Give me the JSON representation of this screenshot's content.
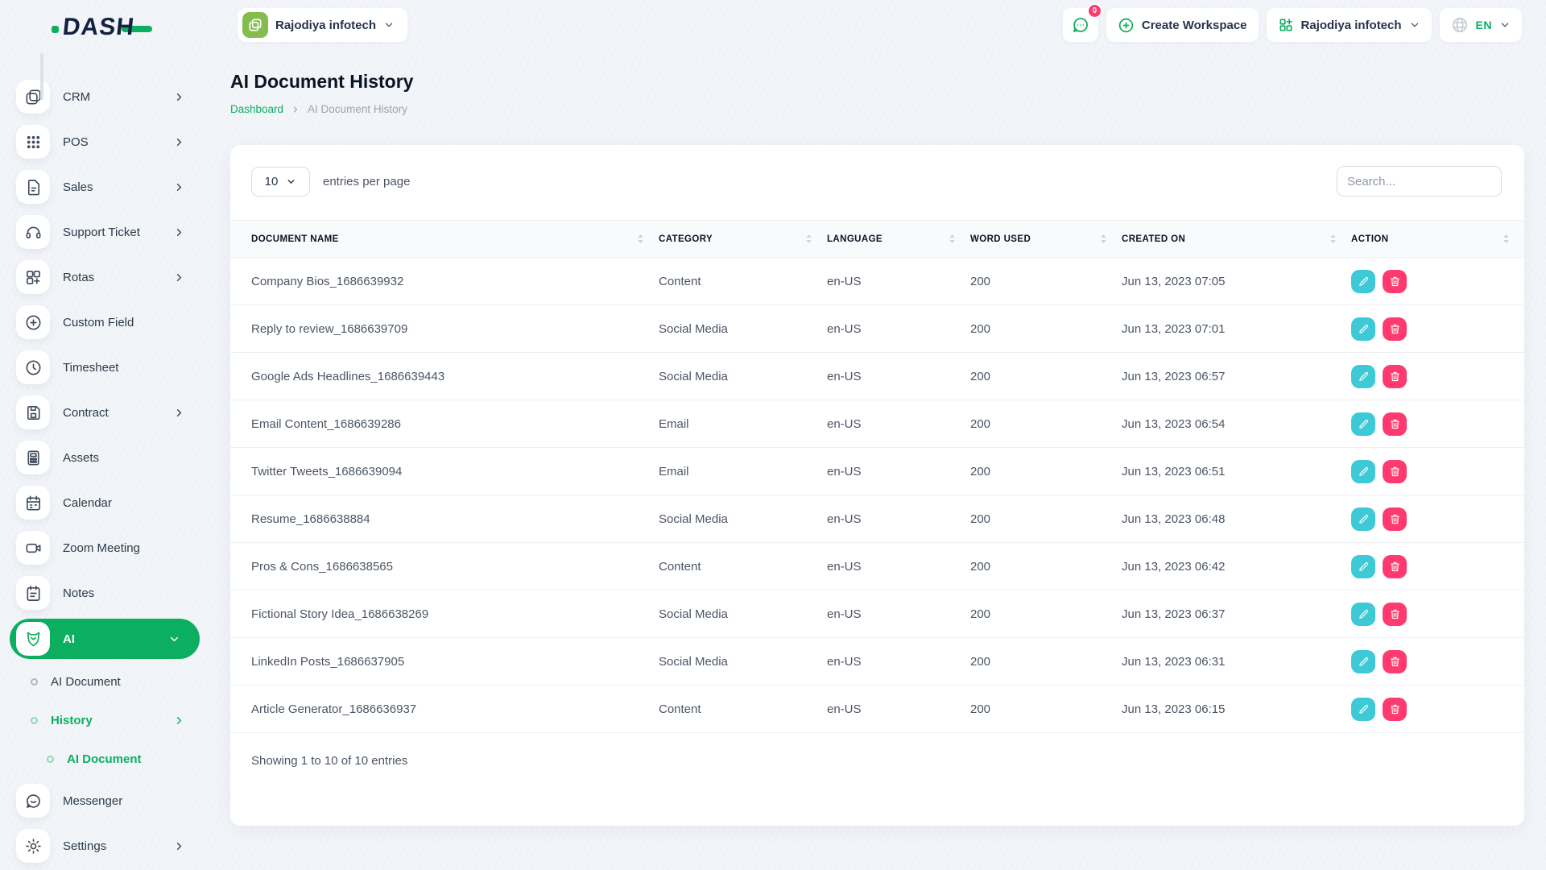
{
  "colors": {
    "accent_green": "#0caf60",
    "avatar_green": "#84bd4d",
    "edit_teal": "#3ec9d6",
    "danger_pink": "#ff3a6e",
    "dark_navy": "#13203f"
  },
  "brand": {
    "name": "DASH"
  },
  "header": {
    "workspace_switcher_label": "Rajodiya infotech",
    "messenger_badge": "0",
    "create_workspace_label": "Create Workspace",
    "company_dropdown_label": "Rajodiya infotech",
    "language_code": "EN"
  },
  "sidebar": {
    "items": [
      {
        "label": "CRM",
        "icon": "crm-icon",
        "chevron": true
      },
      {
        "label": "POS",
        "icon": "pos-icon",
        "chevron": true
      },
      {
        "label": "Sales",
        "icon": "sales-icon",
        "chevron": true
      },
      {
        "label": "Support Ticket",
        "icon": "support-ticket-icon",
        "chevron": true
      },
      {
        "label": "Rotas",
        "icon": "rotas-icon",
        "chevron": true
      },
      {
        "label": "Custom Field",
        "icon": "custom-field-icon",
        "chevron": false
      },
      {
        "label": "Timesheet",
        "icon": "timesheet-icon",
        "chevron": false
      },
      {
        "label": "Contract",
        "icon": "contract-icon",
        "chevron": true
      },
      {
        "label": "Assets",
        "icon": "assets-icon",
        "chevron": false
      },
      {
        "label": "Calendar",
        "icon": "calendar-icon",
        "chevron": false
      },
      {
        "label": "Zoom Meeting",
        "icon": "zoom-meeting-icon",
        "chevron": false
      },
      {
        "label": "Notes",
        "icon": "notes-icon",
        "chevron": false
      },
      {
        "label": "AI",
        "icon": "ai-icon",
        "active": true,
        "chevron": "down"
      },
      {
        "label": "AI Document",
        "level": 1,
        "highlight": false
      },
      {
        "label": "History",
        "level": 1,
        "highlight": true,
        "chevron": true
      },
      {
        "label": "AI Document",
        "level": 2,
        "highlight": true
      },
      {
        "label": "Messenger",
        "icon": "messenger-icon",
        "chevron": false
      },
      {
        "label": "Settings",
        "icon": "settings-icon",
        "chevron": true
      }
    ]
  },
  "page": {
    "title": "AI Document History",
    "breadcrumb_root": "Dashboard",
    "breadcrumb_current": "AI Document History"
  },
  "table_card": {
    "entries_value": "10",
    "entries_label": "entries per page",
    "search_placeholder": "Search...",
    "columns": [
      "DOCUMENT NAME",
      "CATEGORY",
      "LANGUAGE",
      "WORD USED",
      "CREATED ON",
      "ACTION"
    ],
    "rows": [
      {
        "name": "Company Bios_1686639932",
        "category": "Content",
        "language": "en-US",
        "words": "200",
        "created": "Jun 13, 2023 07:05"
      },
      {
        "name": "Reply to review_1686639709",
        "category": "Social Media",
        "language": "en-US",
        "words": "200",
        "created": "Jun 13, 2023 07:01"
      },
      {
        "name": "Google Ads Headlines_1686639443",
        "category": "Social Media",
        "language": "en-US",
        "words": "200",
        "created": "Jun 13, 2023 06:57"
      },
      {
        "name": "Email Content_1686639286",
        "category": "Email",
        "language": "en-US",
        "words": "200",
        "created": "Jun 13, 2023 06:54"
      },
      {
        "name": "Twitter Tweets_1686639094",
        "category": "Email",
        "language": "en-US",
        "words": "200",
        "created": "Jun 13, 2023 06:51"
      },
      {
        "name": "Resume_1686638884",
        "category": "Social Media",
        "language": "en-US",
        "words": "200",
        "created": "Jun 13, 2023 06:48"
      },
      {
        "name": "Pros & Cons_1686638565",
        "category": "Content",
        "language": "en-US",
        "words": "200",
        "created": "Jun 13, 2023 06:42"
      },
      {
        "name": "Fictional Story Idea_1686638269",
        "category": "Social Media",
        "language": "en-US",
        "words": "200",
        "created": "Jun 13, 2023 06:37"
      },
      {
        "name": "LinkedIn Posts_1686637905",
        "category": "Social Media",
        "language": "en-US",
        "words": "200",
        "created": "Jun 13, 2023 06:31"
      },
      {
        "name": "Article Generator_1686636937",
        "category": "Content",
        "language": "en-US",
        "words": "200",
        "created": "Jun 13, 2023 06:15"
      }
    ],
    "footer": "Showing 1 to 10 of 10 entries"
  }
}
